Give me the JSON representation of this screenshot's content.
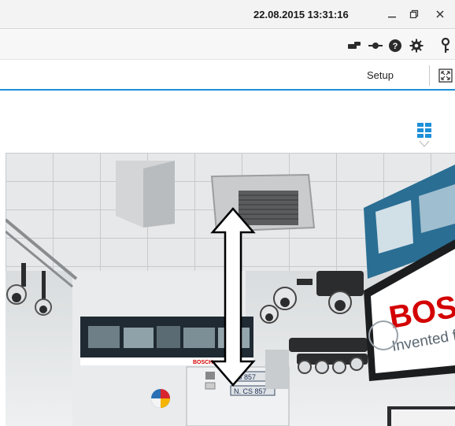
{
  "titlebar": {
    "datetime": "22.08.2015 13:31:16",
    "buttons": {
      "minimize": "minimize-icon",
      "restore": "restore-icon",
      "close": "close-icon"
    }
  },
  "toolbar": {
    "icons": [
      "connection-icon",
      "network-icon",
      "help-icon",
      "gear-icon",
      "key-icon"
    ]
  },
  "tabbar": {
    "setup_label": "Setup",
    "fullscreen_icon": "fullscreen-icon"
  },
  "viewer": {
    "layout_icon": "layout-grid-icon",
    "accent": "#1e8fd8"
  },
  "camera_feed": {
    "brand_sign": "BOSCH",
    "brand_tagline": "Invented f",
    "small_logo": "BOSCH",
    "door_label_1": "CS 857",
    "door_label_2": "N. CS 857",
    "arrow_icon": "vertical-double-arrow-icon"
  }
}
